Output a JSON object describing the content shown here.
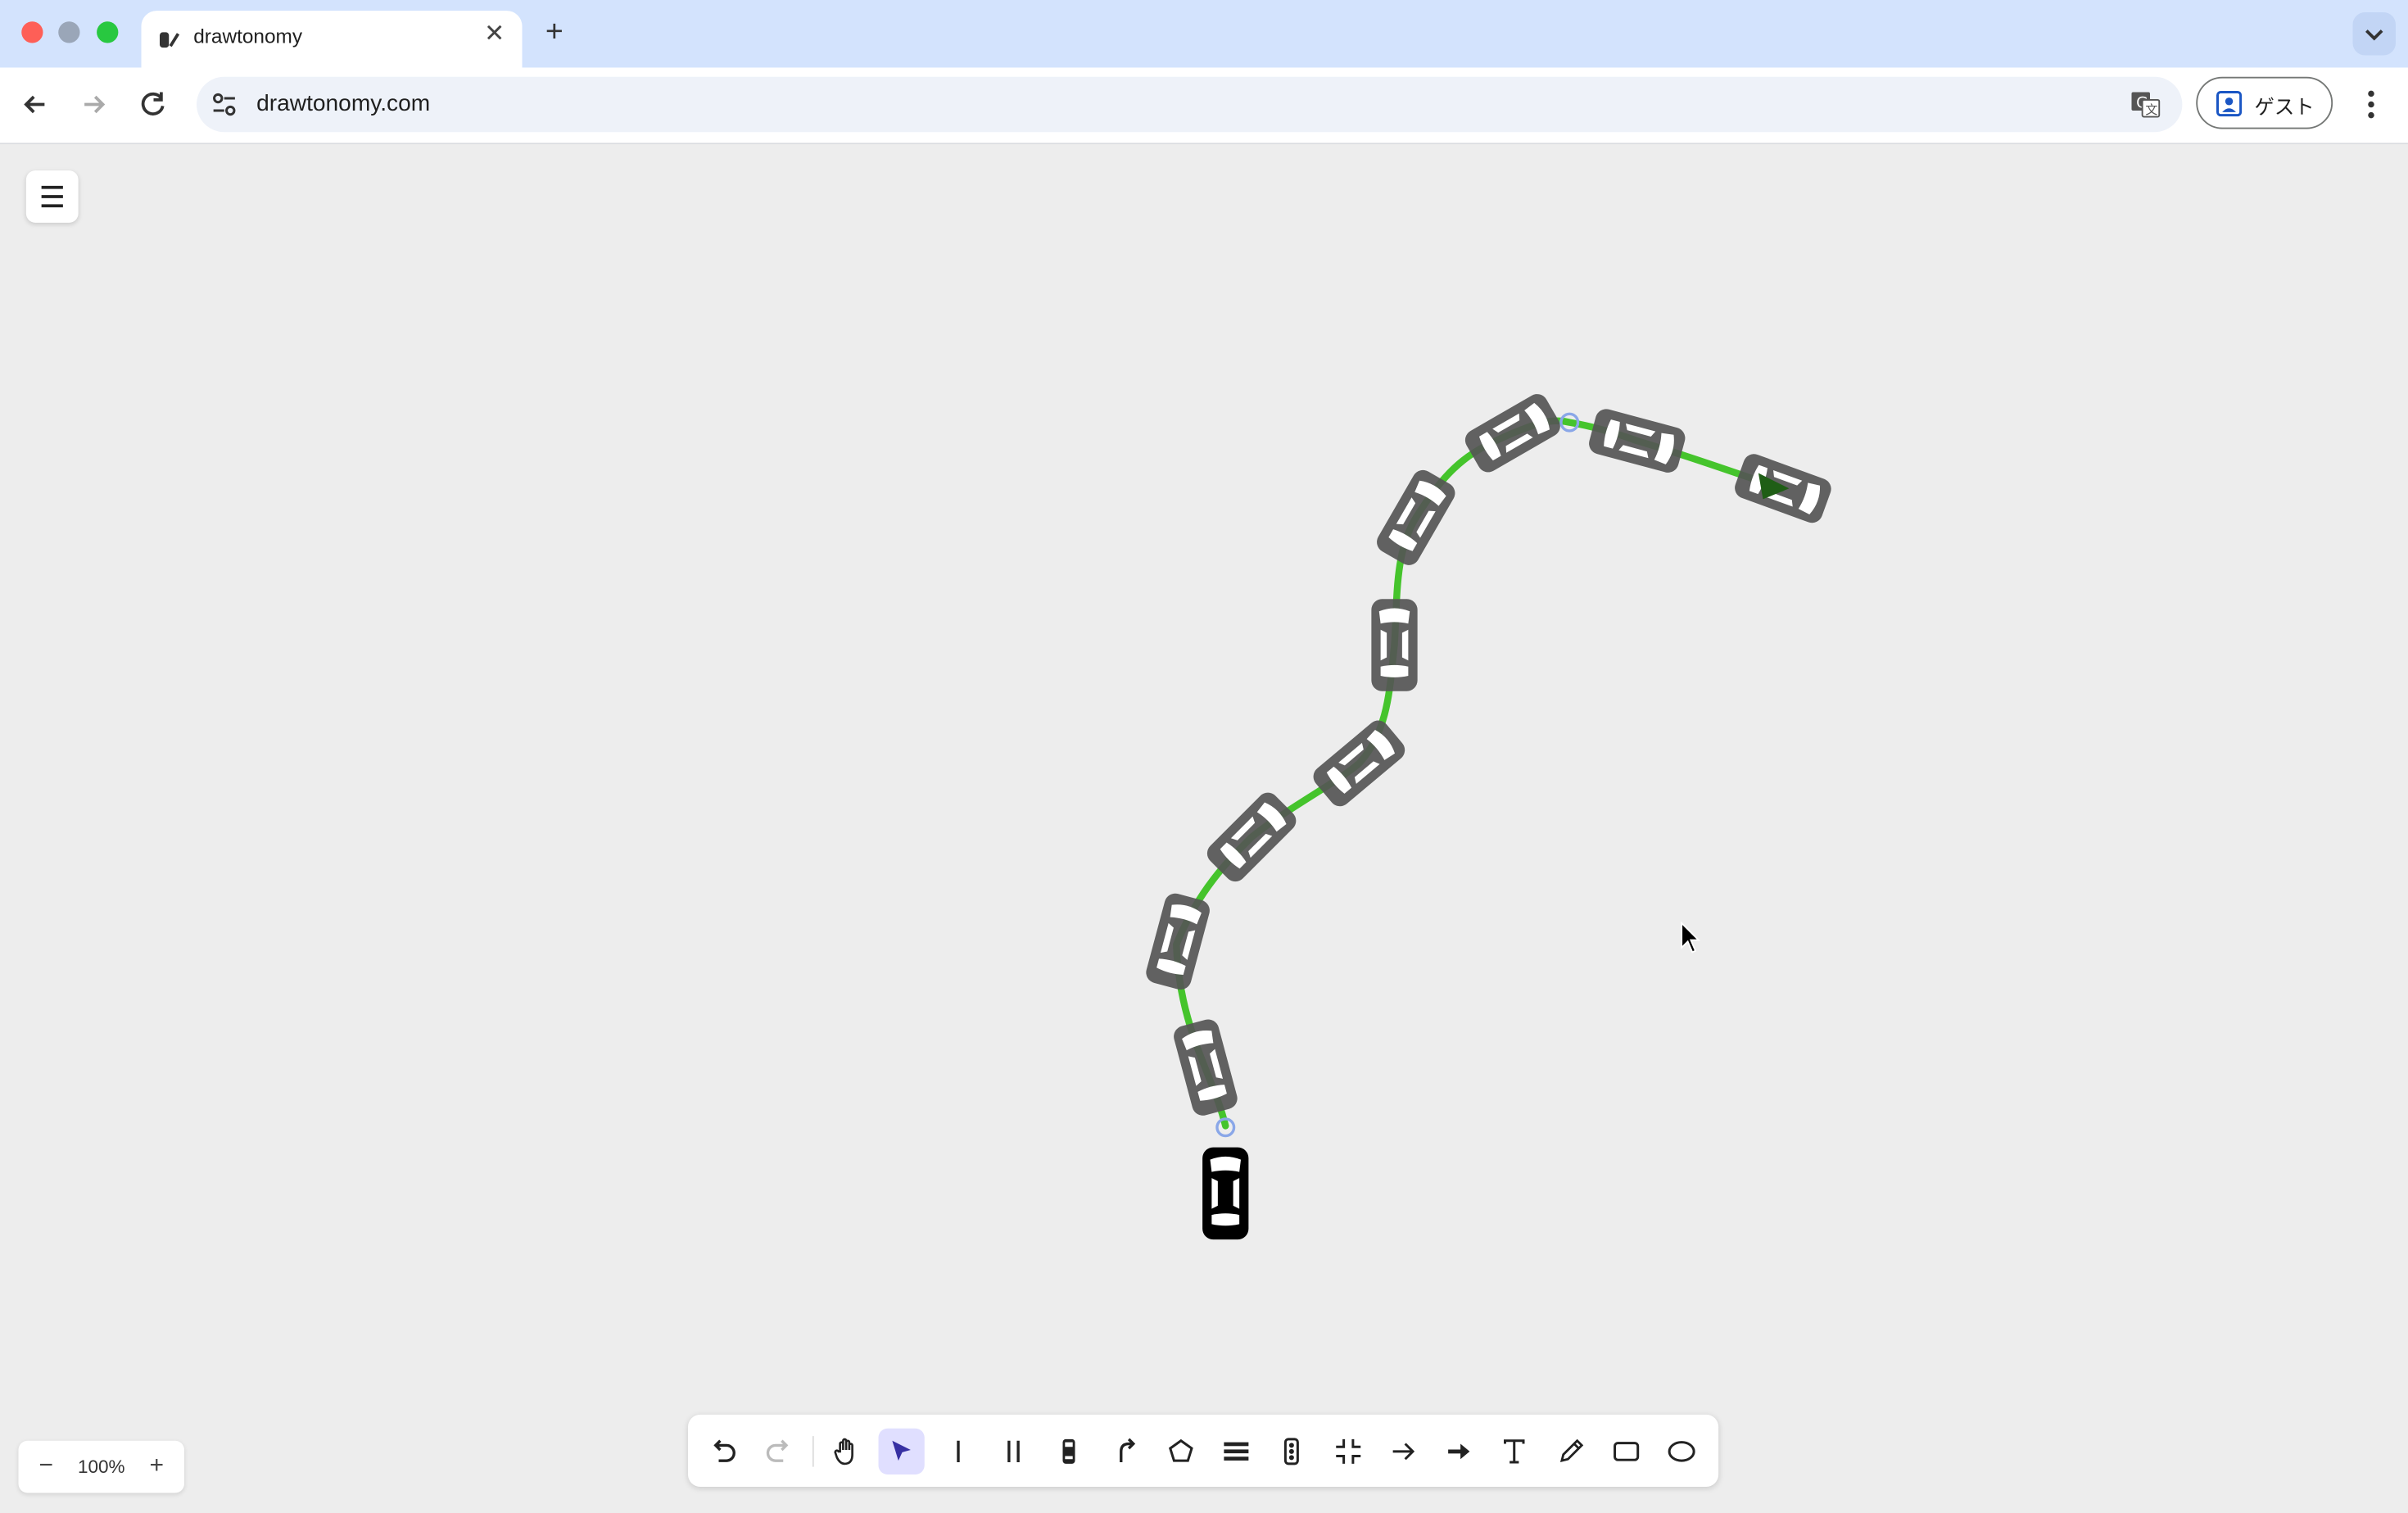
{
  "browser": {
    "tab_title": "drawtonomy",
    "tab_close_icon": "close-icon",
    "new_tab_icon": "plus-icon",
    "url": "drawtonomy.com",
    "profile_label": "ゲスト"
  },
  "zoom": {
    "level": "100%",
    "minus": "−",
    "plus": "+"
  },
  "toolbar_tools": [
    {
      "name": "undo",
      "icon": "undo-icon"
    },
    {
      "name": "redo",
      "icon": "redo-icon"
    },
    {
      "name": "hand",
      "icon": "hand-icon"
    },
    {
      "name": "select",
      "icon": "cursor-icon",
      "active": true
    },
    {
      "name": "single-line",
      "icon": "single-line-icon"
    },
    {
      "name": "double-line",
      "icon": "double-line-icon"
    },
    {
      "name": "vehicle",
      "icon": "vehicle-icon"
    },
    {
      "name": "path",
      "icon": "path-icon"
    },
    {
      "name": "polygon",
      "icon": "polygon-icon"
    },
    {
      "name": "crosswalk",
      "icon": "crosswalk-icon"
    },
    {
      "name": "traffic-light",
      "icon": "traffic-light-icon"
    },
    {
      "name": "intersection",
      "icon": "intersection-icon"
    },
    {
      "name": "arrow",
      "icon": "arrow-icon"
    },
    {
      "name": "thick-arrow",
      "icon": "thick-arrow-icon"
    },
    {
      "name": "text",
      "icon": "text-icon"
    },
    {
      "name": "pencil",
      "icon": "pencil-icon"
    },
    {
      "name": "rectangle",
      "icon": "rectangle-icon"
    },
    {
      "name": "ellipse",
      "icon": "ellipse-icon"
    }
  ],
  "colors": {
    "path": "#45c42c",
    "vehicle_ghost": "#555555",
    "vehicle_main": "#000000",
    "canvas_bg": "#ededed",
    "active_tool_bg": "#e0dfff"
  }
}
